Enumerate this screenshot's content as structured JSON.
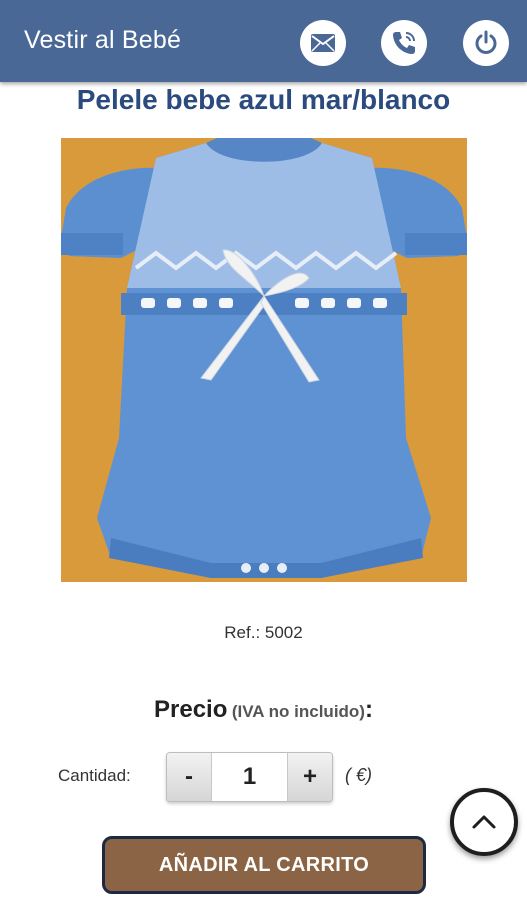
{
  "header": {
    "title": "Vestir al Bebé",
    "icons": [
      "envelope-icon",
      "phone-icon",
      "power-icon"
    ]
  },
  "product": {
    "title": "Pelele bebe azul mar/blanco",
    "ref": "Ref.: 5002",
    "image": "knitted-baby-romper"
  },
  "price": {
    "label": "Precio",
    "note": "(IVA no incluido)",
    "colon": ":"
  },
  "quantity": {
    "label": "Cantidad:",
    "minus": "-",
    "value": "1",
    "plus": "+",
    "currency": "( €)"
  },
  "actions": {
    "add_to_cart": "AÑADIR AL CARRITO",
    "scroll_top_icon": "chevron-up-icon"
  },
  "colors": {
    "header_bg": "#4a6896",
    "title": "#2b4a7e",
    "cart_button": "#8a6444",
    "photo_bg": "#d99a3c"
  }
}
